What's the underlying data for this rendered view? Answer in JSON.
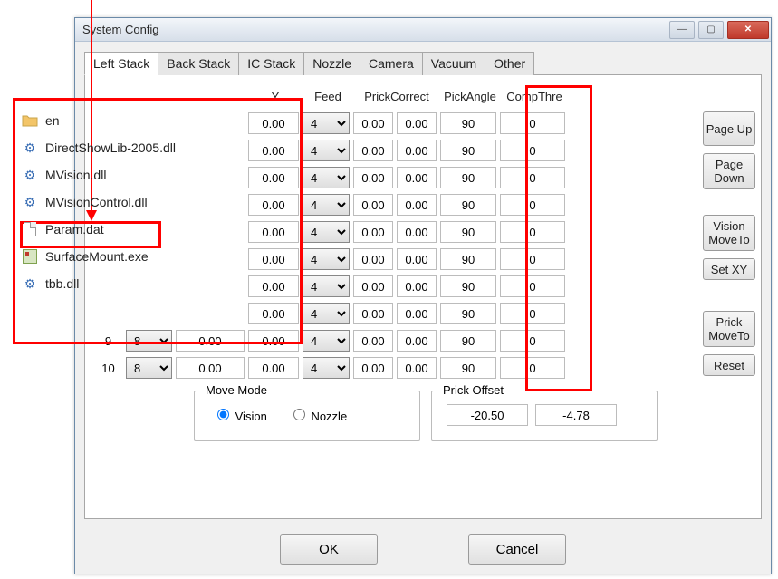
{
  "window": {
    "title": "System Config"
  },
  "tabs": [
    "Left Stack",
    "Back Stack",
    "IC Stack",
    "Nozzle",
    "Camera",
    "Vacuum",
    "Other"
  ],
  "active_tab": 0,
  "columns": {
    "y": "Y",
    "feed": "Feed",
    "prickcorrect": "PrickCorrect",
    "pickangle": "PickAngle",
    "compthre": "CompThre"
  },
  "rows": [
    {
      "idx": "",
      "sel": "",
      "x": "",
      "y": "0.00",
      "feed": "4",
      "pc1": "0.00",
      "pc2": "0.00",
      "pick": "90",
      "comp": "0"
    },
    {
      "idx": "",
      "sel": "",
      "x": "",
      "y": "0.00",
      "feed": "4",
      "pc1": "0.00",
      "pc2": "0.00",
      "pick": "90",
      "comp": "0"
    },
    {
      "idx": "",
      "sel": "",
      "x": "",
      "y": "0.00",
      "feed": "4",
      "pc1": "0.00",
      "pc2": "0.00",
      "pick": "90",
      "comp": "0"
    },
    {
      "idx": "",
      "sel": "",
      "x": "",
      "y": "0.00",
      "feed": "4",
      "pc1": "0.00",
      "pc2": "0.00",
      "pick": "90",
      "comp": "0"
    },
    {
      "idx": "",
      "sel": "",
      "x": "",
      "y": "0.00",
      "feed": "4",
      "pc1": "0.00",
      "pc2": "0.00",
      "pick": "90",
      "comp": "0"
    },
    {
      "idx": "",
      "sel": "",
      "x": "",
      "y": "0.00",
      "feed": "4",
      "pc1": "0.00",
      "pc2": "0.00",
      "pick": "90",
      "comp": "0"
    },
    {
      "idx": "",
      "sel": "",
      "x": "",
      "y": "0.00",
      "feed": "4",
      "pc1": "0.00",
      "pc2": "0.00",
      "pick": "90",
      "comp": "0"
    },
    {
      "idx": "",
      "sel": "",
      "x": "",
      "y": "0.00",
      "feed": "4",
      "pc1": "0.00",
      "pc2": "0.00",
      "pick": "90",
      "comp": "0"
    },
    {
      "idx": "9",
      "sel": "8",
      "x": "0.00",
      "y": "0.00",
      "feed": "4",
      "pc1": "0.00",
      "pc2": "0.00",
      "pick": "90",
      "comp": "0"
    },
    {
      "idx": "10",
      "sel": "8",
      "x": "0.00",
      "y": "0.00",
      "feed": "4",
      "pc1": "0.00",
      "pc2": "0.00",
      "pick": "90",
      "comp": "0"
    }
  ],
  "sidebuttons": {
    "pageup": "Page Up",
    "pagedown": "Page Down",
    "visionmoveto": "Vision MoveTo",
    "setxy": "Set XY",
    "prickmoveto": "Prick MoveTo",
    "reset": "Reset"
  },
  "movemode": {
    "legend": "Move Mode",
    "vision": "Vision",
    "nozzle": "Nozzle",
    "selected": "vision"
  },
  "prickoffset": {
    "legend": "Prick Offset",
    "x": "-20.50",
    "y": "-4.78"
  },
  "dialog": {
    "ok": "OK",
    "cancel": "Cancel"
  },
  "filelist": [
    {
      "name": "en",
      "kind": "folder"
    },
    {
      "name": "DirectShowLib-2005.dll",
      "kind": "dll"
    },
    {
      "name": "MVision.dll",
      "kind": "dll"
    },
    {
      "name": "MVisionControl.dll",
      "kind": "dll"
    },
    {
      "name": "Param.dat",
      "kind": "dat"
    },
    {
      "name": "SurfaceMount.exe",
      "kind": "exe"
    },
    {
      "name": "tbb.dll",
      "kind": "dll"
    }
  ]
}
